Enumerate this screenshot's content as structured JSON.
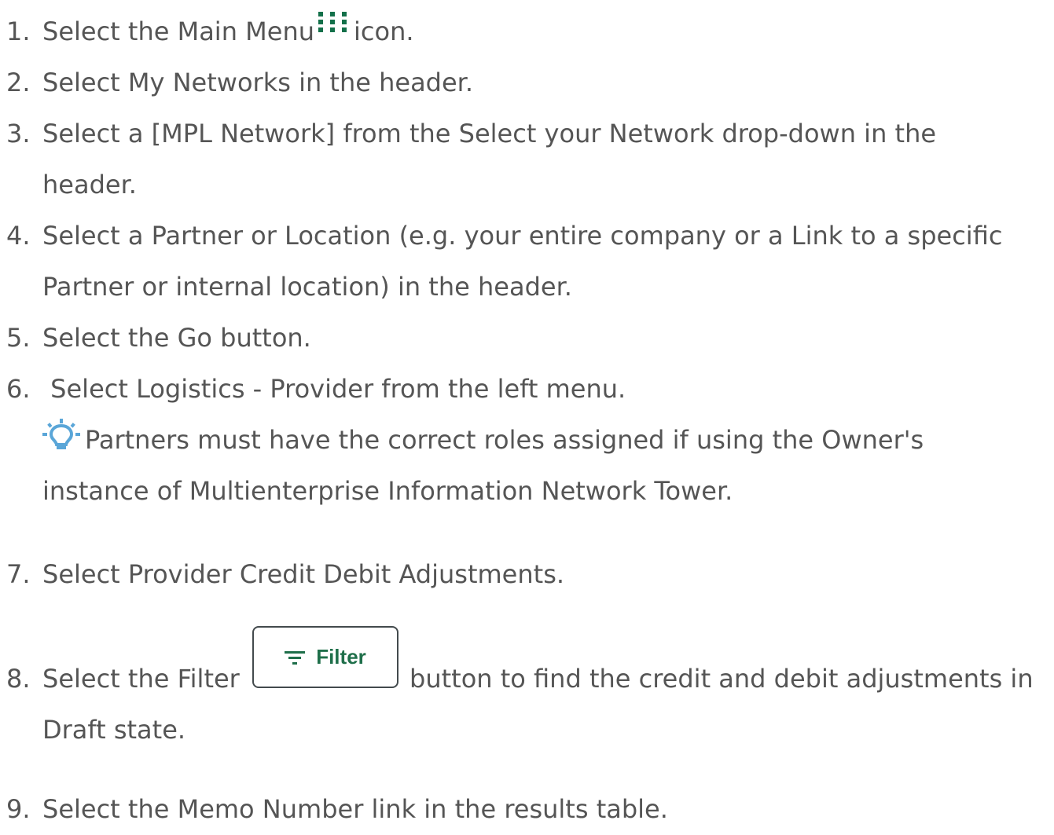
{
  "colors": {
    "text": "#555555",
    "menu_icon_green": "#13704a",
    "bulb_blue": "#5aa6d8",
    "filter_green": "#1f6f4a",
    "filter_border": "#434a4d"
  },
  "steps": [
    {
      "number": "1.",
      "before_icon": "Select the Main Menu",
      "icon": "main-menu-grid-icon",
      "after_icon": "icon."
    },
    {
      "number": "2.",
      "text": "Select My Networks in the header."
    },
    {
      "number": "3.",
      "lines": [
        "Select a [MPL Network] from the Select your Network drop-down in the",
        "header."
      ]
    },
    {
      "number": "4.",
      "lines": [
        "Select a Partner or Location (e.g. your entire company or a Link to a specific",
        "Partner or internal location) in the header."
      ]
    },
    {
      "number": "5.",
      "text": "Select the Go button."
    },
    {
      "number": "6.",
      "text": " Select Logistics - Provider from the left menu.",
      "tip": {
        "icon": "lightbulb-icon",
        "lines": [
          "Partners must have the correct roles assigned if using the Owner's",
          "instance of Multienterprise Information Network Tower."
        ]
      }
    },
    {
      "number": "7.",
      "text": "Select Provider Credit Debit Adjustments."
    },
    {
      "number": "8.",
      "before_button": "Select the Filter",
      "button": {
        "label": "Filter",
        "icon": "filter-lines-icon"
      },
      "after_button": "button to find the credit and debit adjustments in",
      "continuation": "Draft state."
    },
    {
      "number": "9.",
      "text": "Select the Memo Number link in the results table."
    }
  ]
}
